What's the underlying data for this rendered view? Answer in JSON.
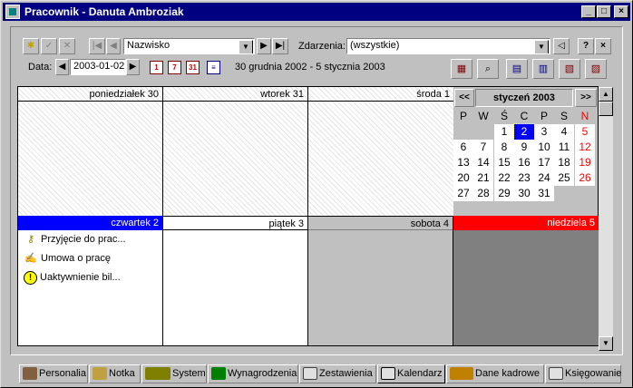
{
  "window": {
    "title": "Pracownik - Danuta Ambroziak",
    "minimize": "_",
    "maximize": "□",
    "close": "×"
  },
  "toolbar": {
    "new_icon": "✱",
    "accept_icon": "✓",
    "cancel_icon": "✕",
    "first_icon": "|◀",
    "prev_icon": "◀",
    "sort_value": "Nazwisko",
    "next_icon": "▶",
    "last_icon": "▶|",
    "events_label": "Zdarzenia:",
    "events_value": "(wszystkie)",
    "back_icon": "◁",
    "help_icon": "?",
    "close_icon": "×",
    "date_label": "Data:",
    "date_value": "2003-01-02",
    "view_day": "1",
    "view_week": "7",
    "view_month": "31",
    "view_list": "≡",
    "range_text": "30 grudnia 2002 - 5 stycznia 2003"
  },
  "week": [
    {
      "label": "poniedziałek 30"
    },
    {
      "label": "wtorek 31"
    },
    {
      "label": "środa 1"
    },
    {
      "label": "czwartek 2"
    },
    {
      "label": "piątek 3"
    },
    {
      "label": "sobota 4"
    },
    {
      "label": "niedziela 5"
    }
  ],
  "events": [
    {
      "label": "Przyjęcie do prac..."
    },
    {
      "label": "Umowa o pracę"
    },
    {
      "label": "Uaktywnienie bil..."
    }
  ],
  "mini_calendar": {
    "prev": "<<",
    "next": ">>",
    "month": "styczeń 2003",
    "weekdays": [
      "P",
      "W",
      "Ś",
      "C",
      "P",
      "S",
      "N"
    ],
    "rows": [
      [
        "",
        "",
        "1",
        "2",
        "3",
        "4",
        "5"
      ],
      [
        "6",
        "7",
        "8",
        "9",
        "10",
        "11",
        "12"
      ],
      [
        "13",
        "14",
        "15",
        "16",
        "17",
        "18",
        "19"
      ],
      [
        "20",
        "21",
        "22",
        "23",
        "24",
        "25",
        "26"
      ],
      [
        "27",
        "28",
        "29",
        "30",
        "31",
        "",
        ""
      ]
    ],
    "selected": "2"
  },
  "tabs": [
    {
      "label": "Personalia"
    },
    {
      "label": "Notka"
    },
    {
      "label": "System"
    },
    {
      "label": "Wynagrodzenia"
    },
    {
      "label": "Zestawienia"
    },
    {
      "label": "Kalendarz"
    },
    {
      "label": "Dane kadrowe"
    },
    {
      "label": "Księgowanie"
    }
  ],
  "colors": {
    "title_bar": "#000080",
    "today_header": "#0000ff",
    "sunday_header": "#ff0000",
    "saturday_bg": "#c0c0c0",
    "sunday_bg": "#808080",
    "selected_day": "#0000ff"
  }
}
